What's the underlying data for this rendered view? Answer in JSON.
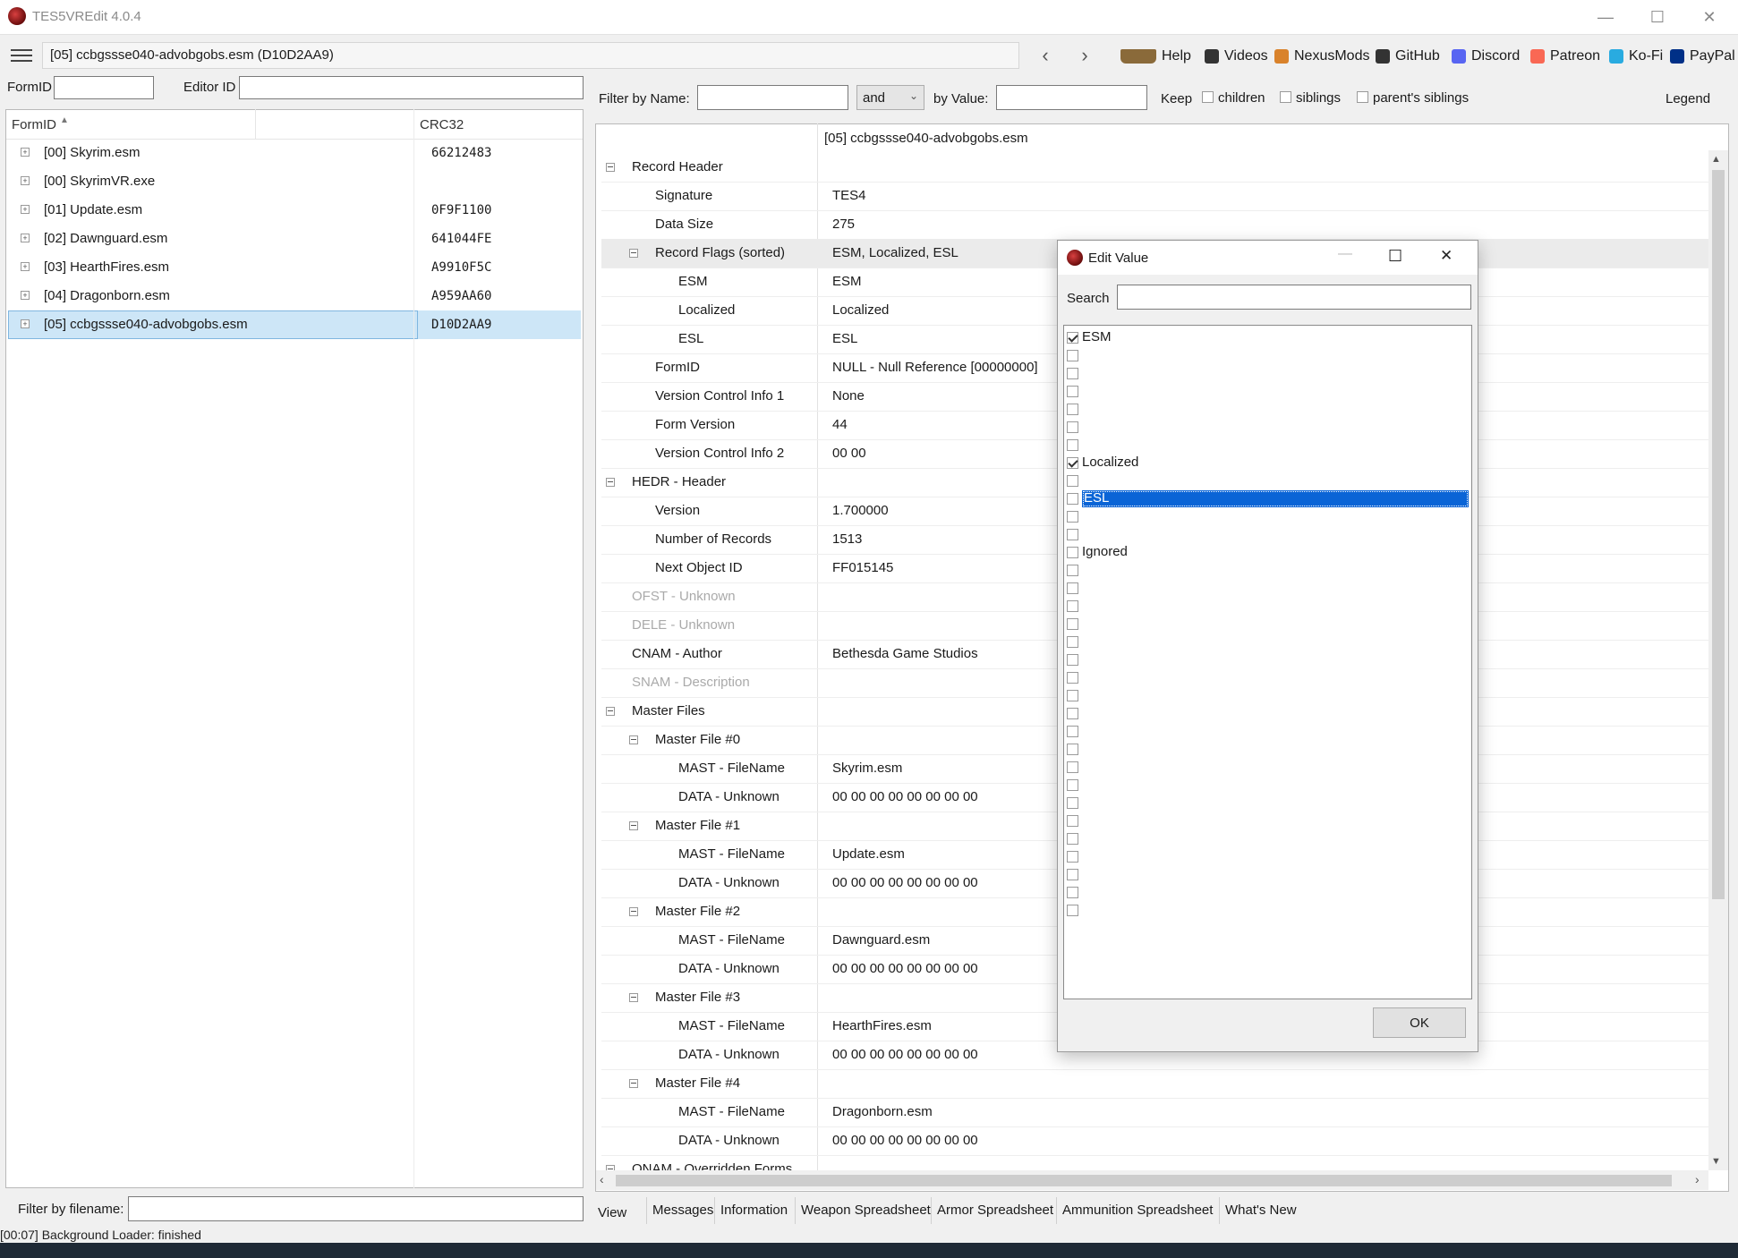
{
  "window": {
    "title": "TES5VREdit 4.0.4"
  },
  "toolbar": {
    "path": "[05] ccbgssse040-advobgobs.esm (D10D2AA9)",
    "links": [
      {
        "label": "Help",
        "icon": "book-icon",
        "color": "#8a6a3a"
      },
      {
        "label": "Videos",
        "icon": "video-icon",
        "color": "#333333"
      },
      {
        "label": "NexusMods",
        "icon": "nexus-icon",
        "color": "#d9822b"
      },
      {
        "label": "GitHub",
        "icon": "github-icon",
        "color": "#333333"
      },
      {
        "label": "Discord",
        "icon": "discord-icon",
        "color": "#5865f2"
      },
      {
        "label": "Patreon",
        "icon": "patreon-icon",
        "color": "#f96854"
      },
      {
        "label": "Ko-Fi",
        "icon": "kofi-icon",
        "color": "#29abe0"
      },
      {
        "label": "PayPal",
        "icon": "paypal-icon",
        "color": "#003087"
      }
    ]
  },
  "left": {
    "formid_label": "FormID",
    "editorid_label": "Editor ID",
    "col_formid": "FormID",
    "col_crc": "CRC32",
    "files": [
      {
        "name": "[00] Skyrim.esm",
        "crc": "66212483"
      },
      {
        "name": "[00] SkyrimVR.exe",
        "crc": ""
      },
      {
        "name": "[01] Update.esm",
        "crc": "0F9F1100"
      },
      {
        "name": "[02] Dawnguard.esm",
        "crc": "641044FE"
      },
      {
        "name": "[03] HearthFires.esm",
        "crc": "A9910F5C"
      },
      {
        "name": "[04] Dragonborn.esm",
        "crc": "A959AA60"
      },
      {
        "name": "[05] ccbgssse040-advobgobs.esm",
        "crc": "D10D2AA9"
      }
    ],
    "filter_label": "Filter by filename:"
  },
  "filterbar": {
    "by_name": "Filter by Name:",
    "op": "and",
    "by_value": "by Value:",
    "keep": "Keep",
    "children": "children",
    "siblings": "siblings",
    "parents_siblings": "parent's siblings",
    "legend": "Legend"
  },
  "record": {
    "file_header": "[05] ccbgssse040-advobgobs.esm",
    "rows": [
      {
        "name": "Record Header",
        "value": "",
        "level": 0,
        "toggle": true
      },
      {
        "name": "Signature",
        "value": "TES4",
        "level": 1
      },
      {
        "name": "Data Size",
        "value": "275",
        "level": 1
      },
      {
        "name": "Record Flags (sorted)",
        "value": "ESM, Localized, ESL",
        "level": 1,
        "toggle": true,
        "hl": true
      },
      {
        "name": "ESM",
        "value": "ESM",
        "level": 2
      },
      {
        "name": "Localized",
        "value": "Localized",
        "level": 2
      },
      {
        "name": "ESL",
        "value": "ESL",
        "level": 2
      },
      {
        "name": "FormID",
        "value": "NULL - Null Reference [00000000]",
        "level": 1
      },
      {
        "name": "Version Control Info 1",
        "value": "None",
        "level": 1
      },
      {
        "name": "Form Version",
        "value": "44",
        "level": 1
      },
      {
        "name": "Version Control Info 2",
        "value": "00 00",
        "level": 1
      },
      {
        "name": "HEDR - Header",
        "value": "",
        "level": 0,
        "toggle": true
      },
      {
        "name": "Version",
        "value": "1.700000",
        "level": 1
      },
      {
        "name": "Number of Records",
        "value": "1513",
        "level": 1
      },
      {
        "name": "Next Object ID",
        "value": "FF015145",
        "level": 1
      },
      {
        "name": "OFST - Unknown",
        "value": "",
        "level": 0,
        "dim": true
      },
      {
        "name": "DELE - Unknown",
        "value": "",
        "level": 0,
        "dim": true
      },
      {
        "name": "CNAM - Author",
        "value": "Bethesda Game Studios",
        "level": 0
      },
      {
        "name": "SNAM - Description",
        "value": "",
        "level": 0,
        "dim": true
      },
      {
        "name": "Master Files",
        "value": "",
        "level": 0,
        "toggle": true
      },
      {
        "name": "Master File #0",
        "value": "",
        "level": 1,
        "toggle": true
      },
      {
        "name": "MAST - FileName",
        "value": "Skyrim.esm",
        "level": 2
      },
      {
        "name": "DATA - Unknown",
        "value": "00 00 00 00 00 00 00 00",
        "level": 2
      },
      {
        "name": "Master File #1",
        "value": "",
        "level": 1,
        "toggle": true
      },
      {
        "name": "MAST - FileName",
        "value": "Update.esm",
        "level": 2
      },
      {
        "name": "DATA - Unknown",
        "value": "00 00 00 00 00 00 00 00",
        "level": 2
      },
      {
        "name": "Master File #2",
        "value": "",
        "level": 1,
        "toggle": true
      },
      {
        "name": "MAST - FileName",
        "value": "Dawnguard.esm",
        "level": 2
      },
      {
        "name": "DATA - Unknown",
        "value": "00 00 00 00 00 00 00 00",
        "level": 2
      },
      {
        "name": "Master File #3",
        "value": "",
        "level": 1,
        "toggle": true
      },
      {
        "name": "MAST - FileName",
        "value": "HearthFires.esm",
        "level": 2
      },
      {
        "name": "DATA - Unknown",
        "value": "00 00 00 00 00 00 00 00",
        "level": 2
      },
      {
        "name": "Master File #4",
        "value": "",
        "level": 1,
        "toggle": true
      },
      {
        "name": "MAST - FileName",
        "value": "Dragonborn.esm",
        "level": 2
      },
      {
        "name": "DATA - Unknown",
        "value": "00 00 00 00 00 00 00 00",
        "level": 2
      },
      {
        "name": "ONAM - Overridden Forms",
        "value": "",
        "level": 0,
        "toggle": true
      }
    ]
  },
  "tabs": [
    "View",
    "Messages",
    "Information",
    "Weapon Spreadsheet",
    "Armor Spreadsheet",
    "Ammunition Spreadsheet",
    "What's New"
  ],
  "status": "[00:07] Background Loader: finished",
  "dialog": {
    "title": "Edit Value",
    "search_label": "Search",
    "flags": [
      {
        "label": "ESM",
        "checked": true
      },
      {
        "label": "",
        "checked": false
      },
      {
        "label": "",
        "checked": false
      },
      {
        "label": "",
        "checked": false
      },
      {
        "label": "",
        "checked": false
      },
      {
        "label": "",
        "checked": false
      },
      {
        "label": "",
        "checked": false
      },
      {
        "label": "Localized",
        "checked": true
      },
      {
        "label": "",
        "checked": false
      },
      {
        "label": "ESL",
        "checked": false,
        "selected": true
      },
      {
        "label": "",
        "checked": false
      },
      {
        "label": "",
        "checked": false
      },
      {
        "label": "Ignored",
        "checked": false
      },
      {
        "label": "",
        "checked": false
      },
      {
        "label": "",
        "checked": false
      },
      {
        "label": "",
        "checked": false
      },
      {
        "label": "",
        "checked": false
      },
      {
        "label": "",
        "checked": false
      },
      {
        "label": "",
        "checked": false
      },
      {
        "label": "",
        "checked": false
      },
      {
        "label": "",
        "checked": false
      },
      {
        "label": "",
        "checked": false
      },
      {
        "label": "",
        "checked": false
      },
      {
        "label": "",
        "checked": false
      },
      {
        "label": "",
        "checked": false
      },
      {
        "label": "",
        "checked": false
      },
      {
        "label": "",
        "checked": false
      },
      {
        "label": "",
        "checked": false
      },
      {
        "label": "",
        "checked": false
      },
      {
        "label": "",
        "checked": false
      },
      {
        "label": "",
        "checked": false
      },
      {
        "label": "",
        "checked": false
      },
      {
        "label": "",
        "checked": false
      }
    ],
    "ok": "OK"
  }
}
